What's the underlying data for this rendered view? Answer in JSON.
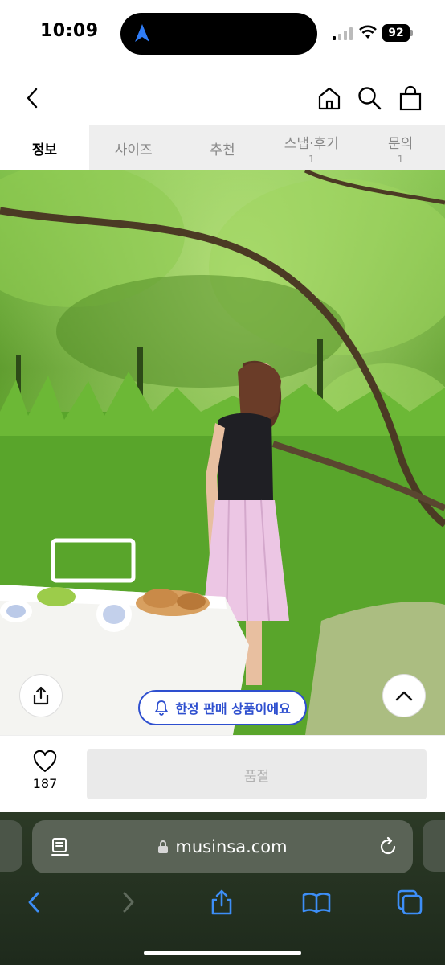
{
  "status": {
    "time": "10:09",
    "battery": "92"
  },
  "tabs": [
    {
      "label": "정보",
      "count": ""
    },
    {
      "label": "사이즈",
      "count": ""
    },
    {
      "label": "추천",
      "count": ""
    },
    {
      "label": "스냅·후기",
      "count": "1"
    },
    {
      "label": "문의",
      "count": "1"
    }
  ],
  "banner": {
    "limited_text": "한정 판매 상품이에요"
  },
  "buy": {
    "like_count": "187",
    "soldout_label": "품절"
  },
  "browser": {
    "url": "musinsa.com"
  },
  "colors": {
    "accent": "#2e4fcf",
    "safari_tint": "#2c3a26"
  },
  "icons": [
    "back-icon",
    "home-icon",
    "search-icon",
    "bag-icon",
    "share-icon",
    "chevron-up-icon",
    "bell-icon",
    "heart-icon",
    "reader-icon",
    "lock-icon",
    "reload-icon",
    "forward-icon",
    "bookmarks-icon",
    "tabs-icon"
  ]
}
